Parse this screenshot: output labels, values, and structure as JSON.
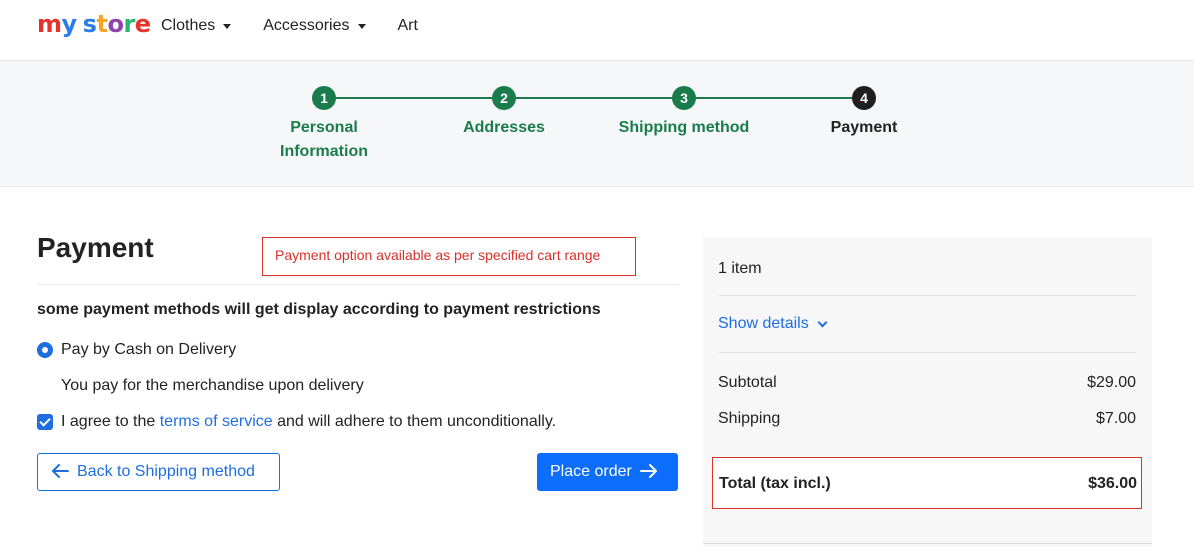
{
  "header": {
    "logo": {
      "parts": [
        "m",
        "y",
        " ",
        "s",
        "t",
        "o",
        "r",
        "e"
      ]
    },
    "nav": [
      {
        "label": "Clothes",
        "dropdown": true
      },
      {
        "label": "Accessories",
        "dropdown": true
      },
      {
        "label": "Art",
        "dropdown": false
      }
    ]
  },
  "stepper": {
    "steps": [
      {
        "number": "1",
        "label_line1": "Personal",
        "label_line2": "Information",
        "state": "done"
      },
      {
        "number": "2",
        "label_line1": "Addresses",
        "label_line2": "",
        "state": "done"
      },
      {
        "number": "3",
        "label_line1": "Shipping method",
        "label_line2": "",
        "state": "done"
      },
      {
        "number": "4",
        "label_line1": "Payment",
        "label_line2": "",
        "state": "current"
      }
    ]
  },
  "payment": {
    "title": "Payment",
    "notice": "Payment option available as per specified cart range",
    "restriction_text": "some payment methods will get display according to payment restrictions",
    "option_label": "Pay by Cash on Delivery",
    "option_description": "You pay for the merchandise upon delivery",
    "terms_prefix": "I agree to the ",
    "terms_link": "terms of service",
    "terms_suffix": " and will adhere to them unconditionally.",
    "back_button": "Back to Shipping method",
    "place_order_button": "Place order"
  },
  "summary": {
    "items_count": "1 item",
    "show_details": "Show details",
    "subtotal_label": "Subtotal",
    "subtotal_value": "$29.00",
    "shipping_label": "Shipping",
    "shipping_value": "$7.00",
    "total_label": "Total (tax incl.)",
    "total_value": "$36.00"
  },
  "colors": {
    "accent": "#1e6ee0",
    "success": "#1a7c4c",
    "error": "#d8312b"
  }
}
